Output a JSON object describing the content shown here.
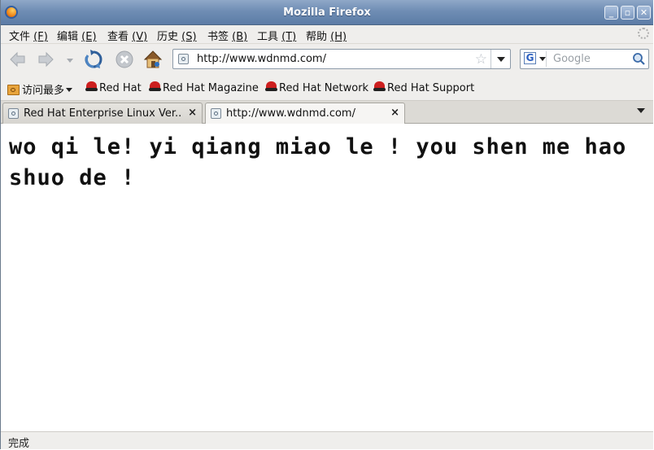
{
  "window": {
    "title": "Mozilla Firefox"
  },
  "menu": [
    {
      "label": "文件",
      "key": "(F)"
    },
    {
      "label": "编辑",
      "key": "(E)"
    },
    {
      "label": "查看",
      "key": "(V)"
    },
    {
      "label": "历史",
      "key": "(S)"
    },
    {
      "label": "书签",
      "key": "(B)"
    },
    {
      "label": "工具",
      "key": "(T)"
    },
    {
      "label": "帮助",
      "key": "(H)"
    }
  ],
  "nav": {
    "url": "http://www.wdnmd.com/",
    "search_placeholder": "Google",
    "search_engine": "G"
  },
  "bookmarks": {
    "most_visited": "访问最多",
    "items": [
      "Red Hat",
      "Red Hat Magazine",
      "Red Hat Network",
      "Red Hat Support"
    ]
  },
  "tabs": [
    {
      "label": "Red Hat Enterprise Linux Ver...",
      "close": "×"
    },
    {
      "label": "http://www.wdnmd.com/",
      "close": "×"
    }
  ],
  "page": {
    "body_text": "wo qi le! yi qiang miao le ! you shen me hao shuo de !"
  },
  "status": {
    "text": "完成"
  },
  "icons": {
    "window": "firefox-icon",
    "back": "back-arrow-icon",
    "forward": "forward-arrow-icon",
    "reload": "reload-icon",
    "stop": "stop-icon",
    "home": "home-icon",
    "bookmark_star": "star-icon",
    "search": "magnifier-icon"
  }
}
